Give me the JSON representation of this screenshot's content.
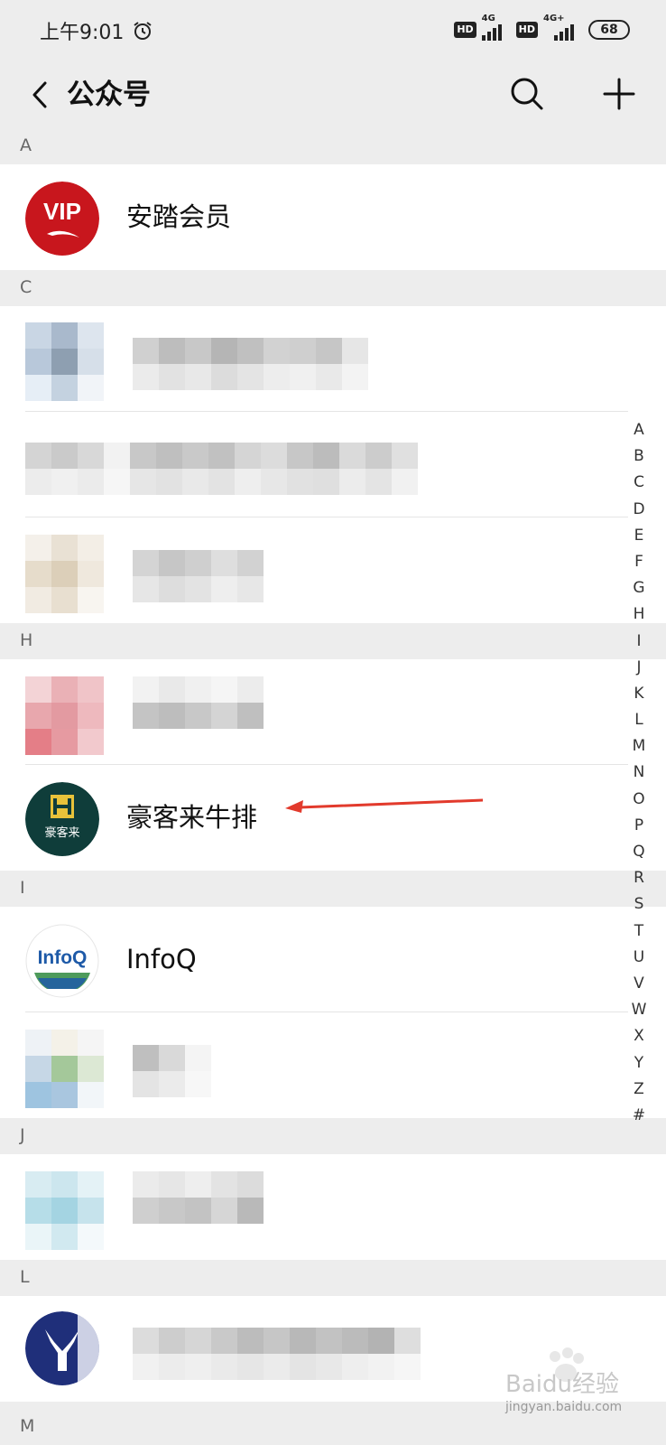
{
  "status_bar": {
    "time": "上午9:01",
    "network1_hd": "HD",
    "network1_type": "4G",
    "network2_hd": "HD",
    "network2_type": "4G+",
    "battery": "68"
  },
  "nav": {
    "title": "公众号"
  },
  "sections": {
    "a": "A",
    "c": "C",
    "h": "H",
    "i": "I",
    "j": "J",
    "l": "L",
    "m": "M"
  },
  "accounts": {
    "anta": {
      "name": "安踏会员",
      "avatar_text": "VIP"
    },
    "haokelai": {
      "name": "豪客来牛排",
      "avatar_text": "豪客来"
    },
    "infoq": {
      "name": "InfoQ",
      "avatar_text": "InfoQ"
    }
  },
  "index_bar": [
    "A",
    "B",
    "C",
    "D",
    "E",
    "F",
    "G",
    "H",
    "I",
    "J",
    "K",
    "L",
    "M",
    "N",
    "O",
    "P",
    "Q",
    "R",
    "S",
    "T",
    "U",
    "V",
    "W",
    "X",
    "Y",
    "Z",
    "#"
  ],
  "watermark": {
    "brand": "Baidu经验",
    "url": "jingyan.baidu.com"
  },
  "colors": {
    "background": "#ededed",
    "row": "#ffffff",
    "anta_red": "#c8161d",
    "haokelai_green": "#0f3d3a",
    "haokelai_yellow": "#e8c23a",
    "infoq_blue": "#1e5aa8",
    "annotation_arrow": "#e23a2c"
  }
}
